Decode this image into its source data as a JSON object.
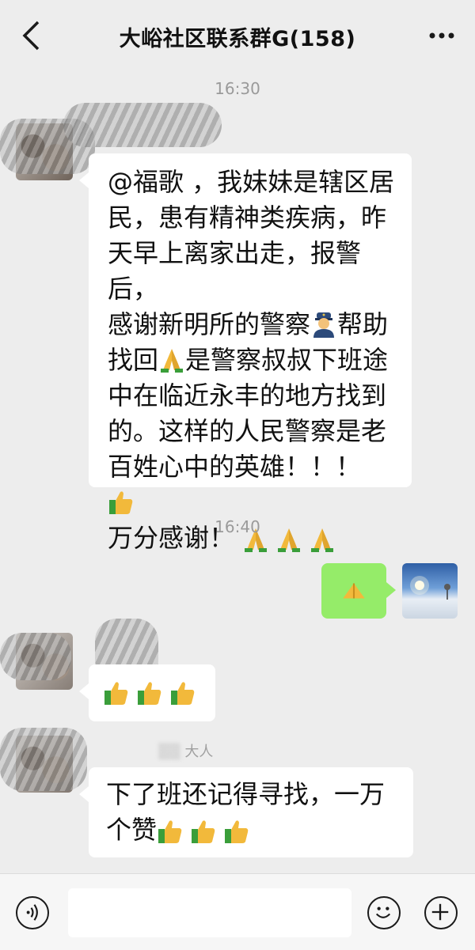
{
  "header": {
    "title": "大峪社区联系群G(158)",
    "back_icon": "chevron-left-icon",
    "more_icon": "more-dots-icon"
  },
  "messages": [
    {
      "type": "timestamp",
      "text": "16:30"
    },
    {
      "type": "received",
      "sender_name": "",
      "text": "@福歌 ，我妹妹是辖区居民，患有精神类疾病，昨天早上离家出走，报警后，感谢新明所的警察👮帮助找回🙏是警察叔叔下班途中在临近永丰的地方找到的。这样的人民警察是老百姓心中的英雄！！！👍万分感谢！🙏🙏🙏"
    },
    {
      "type": "timestamp",
      "text": "16:40"
    },
    {
      "type": "sent",
      "text": "🙏"
    },
    {
      "type": "received",
      "sender_name": "",
      "text": "👍👍👍"
    },
    {
      "type": "received",
      "sender_name": "大人",
      "text": "下了班还记得寻找，一万个赞👍👍👍"
    }
  ],
  "msg1_lines": [
    "@福歌 ，我妹妹是辖区居",
    "民，患有精神类疾病，昨",
    "天早上离家出走，报警后，",
    "感谢新明所的警察",
    "帮助",
    "找回",
    "是警察叔叔下班途",
    "中在临近永丰的地方找到",
    "的。这样的人民警察是老",
    "百姓心中的英雄！！！",
    "万分感谢！"
  ],
  "msg4_lines": [
    "下了班还记得寻找，一万",
    "个赞"
  ],
  "input_bar": {
    "voice_icon": "voice-icon",
    "emoji_icon": "smiley-icon",
    "plus_icon": "plus-icon",
    "input_value": ""
  },
  "colors": {
    "background": "#ededed",
    "received_bubble": "#ffffff",
    "sent_bubble": "#95ec69",
    "timestamp": "#9a9a9a"
  }
}
